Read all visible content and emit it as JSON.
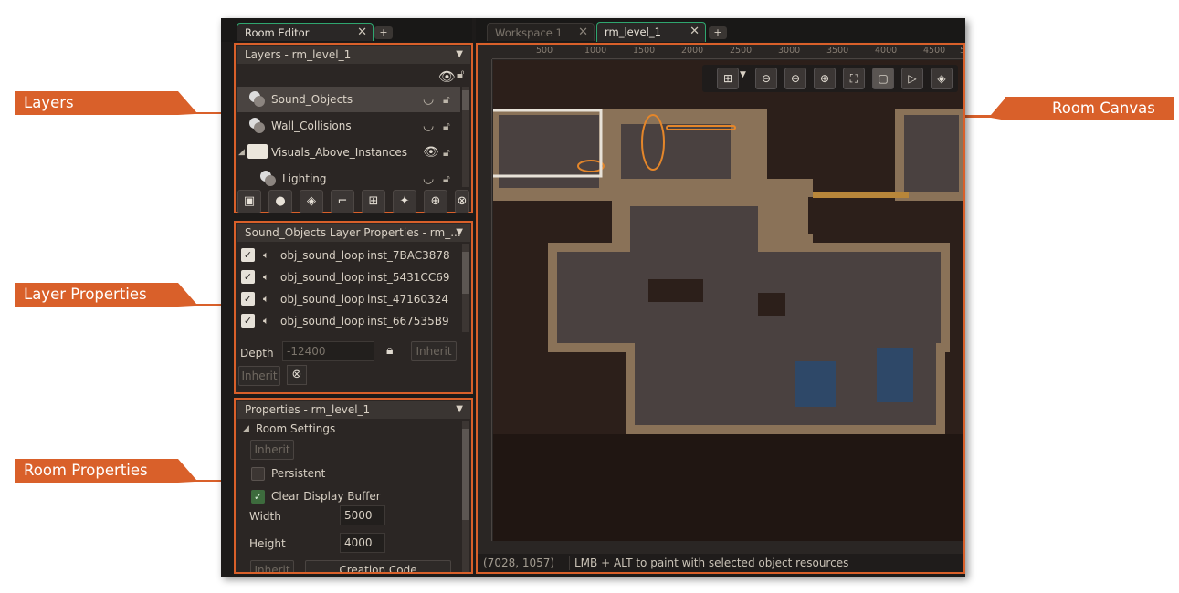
{
  "callouts": {
    "layers": "Layers",
    "layer_properties": "Layer Properties",
    "room_properties": "Room Properties",
    "room_canvas": "Room Canvas"
  },
  "left_tabs": {
    "room_editor": "Room Editor",
    "add": "+"
  },
  "right_tabs": {
    "workspace": "Workspace 1",
    "room": "rm_level_1",
    "add": "+"
  },
  "layers_panel": {
    "title": "Layers - rm_level_1",
    "items": [
      {
        "label": "Sound_Objects",
        "selected": true,
        "visible": false
      },
      {
        "label": "Wall_Collisions",
        "selected": false,
        "visible": false
      },
      {
        "label": "Visuals_Above_Instances",
        "selected": false,
        "visible": true
      },
      {
        "label": "Lighting",
        "selected": false,
        "visible": false
      }
    ]
  },
  "layer_props": {
    "title": "Sound_Objects Layer Properties - rm_...",
    "instances": [
      {
        "object": "obj_sound_loop",
        "id": "inst_7BAC3878"
      },
      {
        "object": "obj_sound_loop",
        "id": "inst_5431CC69"
      },
      {
        "object": "obj_sound_loop",
        "id": "inst_47160324"
      },
      {
        "object": "obj_sound_loop",
        "id": "inst_667535B9"
      }
    ],
    "depth_label": "Depth",
    "depth_value": "-12400",
    "inherit": "Inherit"
  },
  "room_props": {
    "title": "Properties - rm_level_1",
    "section": "Room Settings",
    "inherit": "Inherit",
    "persistent": "Persistent",
    "clear_display": "Clear Display Buffer",
    "width_label": "Width",
    "width_value": "5000",
    "height_label": "Height",
    "height_value": "4000",
    "creation_code": "Creation Code"
  },
  "ruler": {
    "ticks": [
      "500",
      "1000",
      "1500",
      "2000",
      "2500",
      "3000",
      "3500",
      "4000",
      "4500",
      "5"
    ]
  },
  "status": {
    "coords": "(7028, 1057)",
    "hint": "LMB + ALT to paint with selected object resources"
  },
  "colors": {
    "accent": "#d9602a",
    "tab_active": "#2fa66f"
  }
}
